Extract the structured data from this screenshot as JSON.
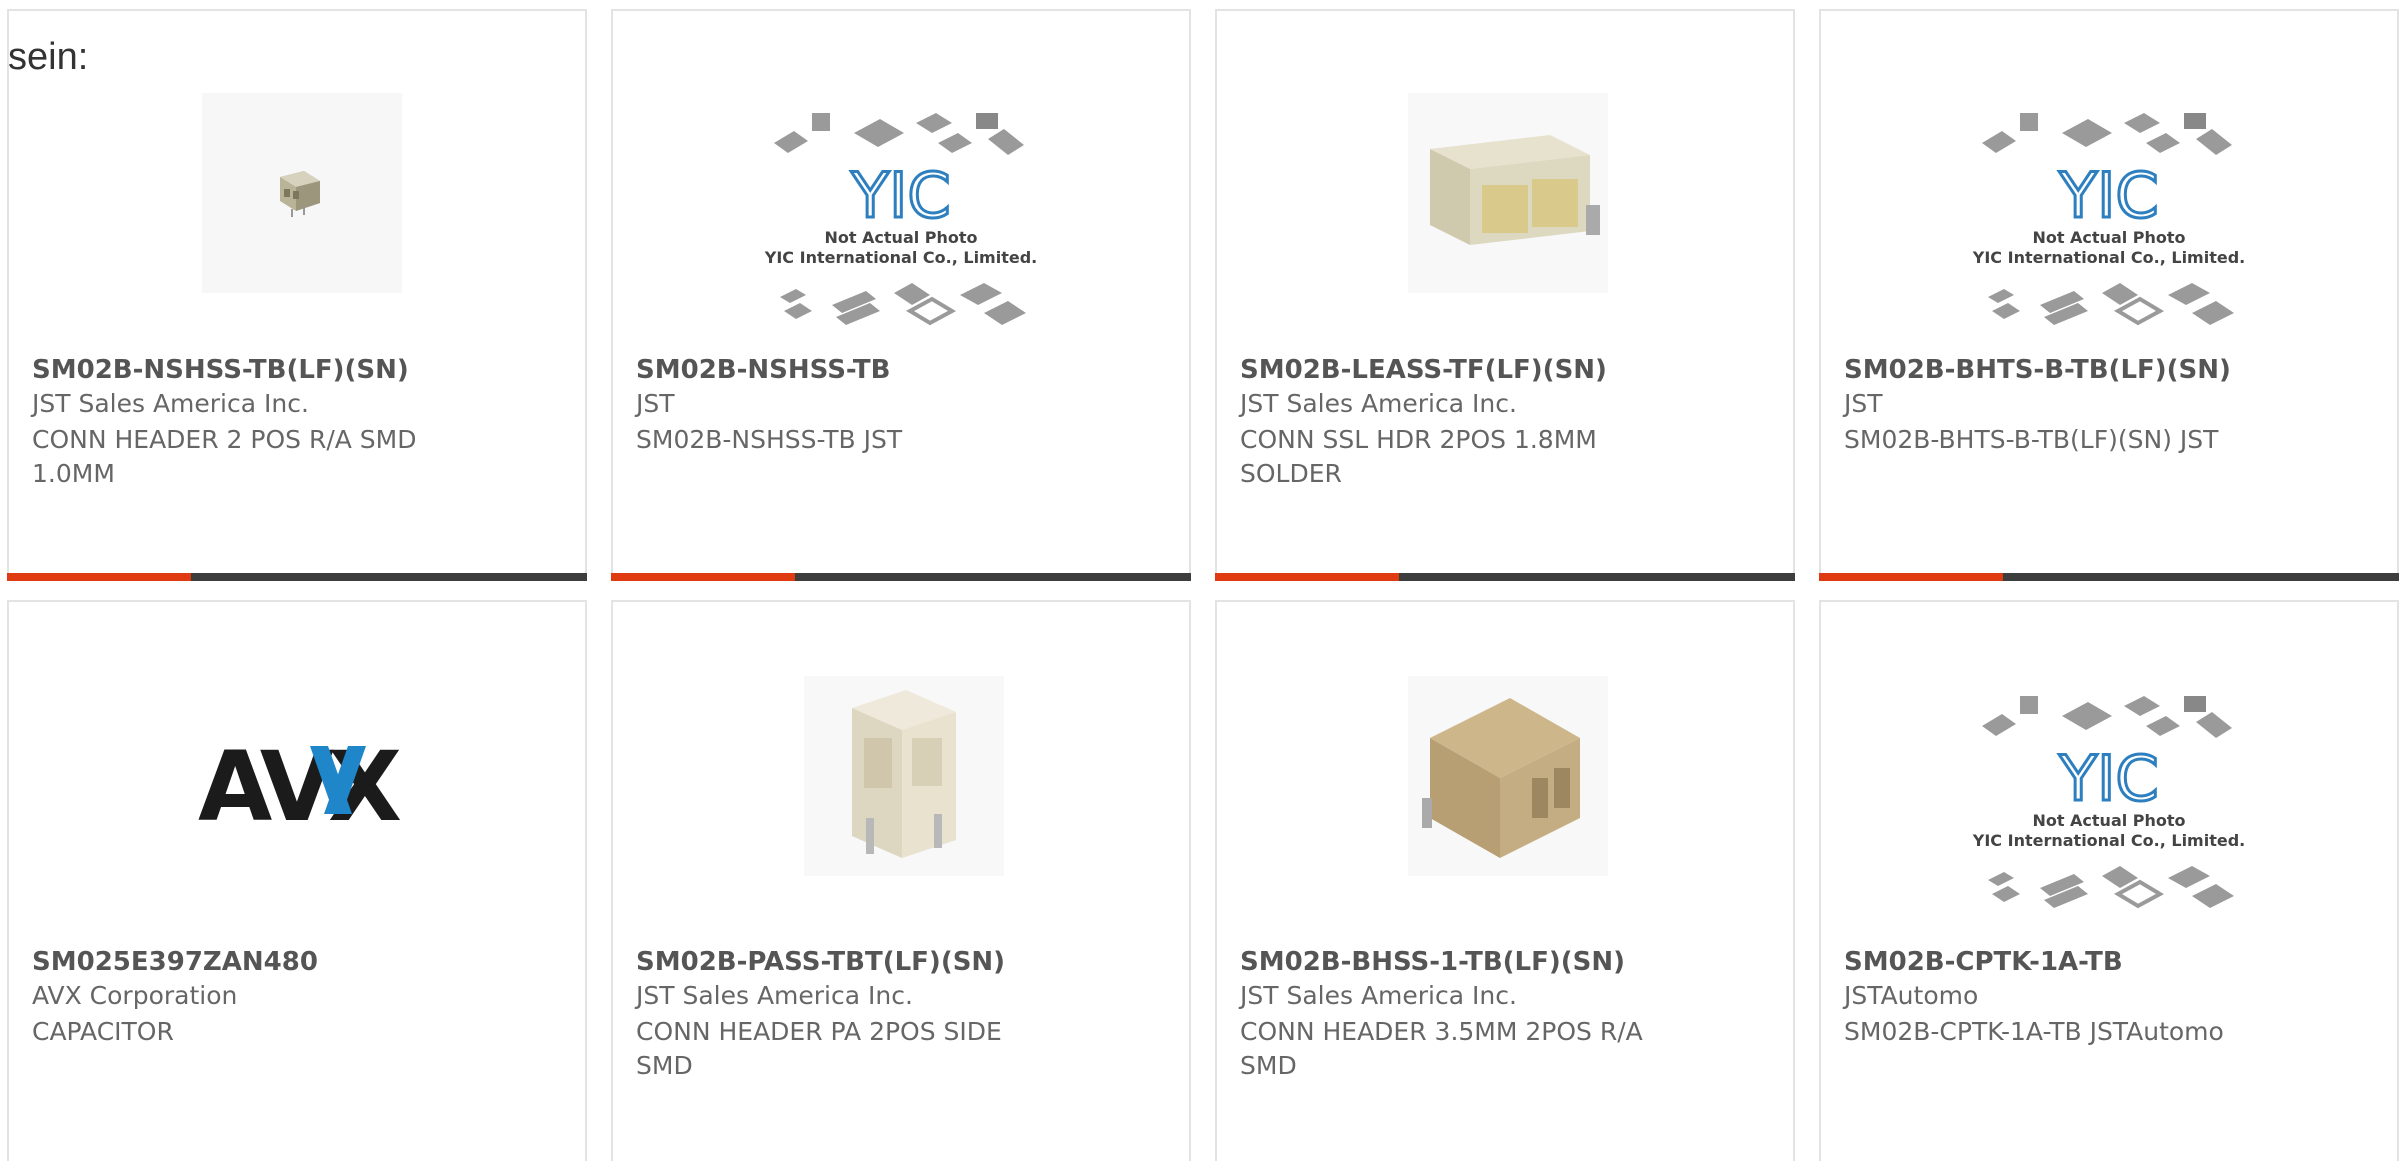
{
  "heading": "sein:",
  "accent_color": "#e03a12",
  "bar_color": "#3d3d3d",
  "cards": [
    {
      "title": "SM02B-NSHSS-TB(LF)(SN)",
      "manufacturer": "JST Sales America Inc.",
      "description": "CONN HEADER 2 POS R/A SMD 1.0MM",
      "image": "connector-small-photo"
    },
    {
      "title": "SM02B-NSHSS-TB",
      "manufacturer": "JST",
      "description": "SM02B-NSHSS-TB JST",
      "image": "yic-placeholder",
      "placeholder": {
        "brand": "YIC",
        "line1": "Not Actual Photo",
        "line2": "YIC International Co., Limited."
      }
    },
    {
      "title": "SM02B-LEASS-TF(LF)(SN)",
      "manufacturer": "JST Sales America Inc.",
      "description": "CONN SSL HDR 2POS 1.8MM SOLDER",
      "image": "connector-header-photo"
    },
    {
      "title": "SM02B-BHTS-B-TB(LF)(SN)",
      "manufacturer": "JST",
      "description": "SM02B-BHTS-B-TB(LF)(SN) JST",
      "image": "yic-placeholder",
      "placeholder": {
        "brand": "YIC",
        "line1": "Not Actual Photo",
        "line2": "YIC International Co., Limited."
      }
    },
    {
      "title": "SM025E397ZAN480",
      "manufacturer": "AVX Corporation",
      "description": "CAPACITOR",
      "image": "avx-logo",
      "logo_text": "AVX"
    },
    {
      "title": "SM02B-PASS-TBT(LF)(SN)",
      "manufacturer": "JST Sales America Inc.",
      "description": "CONN HEADER PA 2POS SIDE SMD",
      "image": "connector-side-photo"
    },
    {
      "title": "SM02B-BHSS-1-TB(LF)(SN)",
      "manufacturer": "JST Sales America Inc.",
      "description": "CONN HEADER 3.5MM 2POS R/A SMD",
      "image": "connector-tan-photo"
    },
    {
      "title": "SM02B-CPTK-1A-TB",
      "manufacturer": "JSTAutomo",
      "description": "SM02B-CPTK-1A-TB JSTAutomo",
      "image": "yic-placeholder",
      "placeholder": {
        "brand": "YIC",
        "line1": "Not Actual Photo",
        "line2": "YIC International Co., Limited."
      }
    }
  ]
}
